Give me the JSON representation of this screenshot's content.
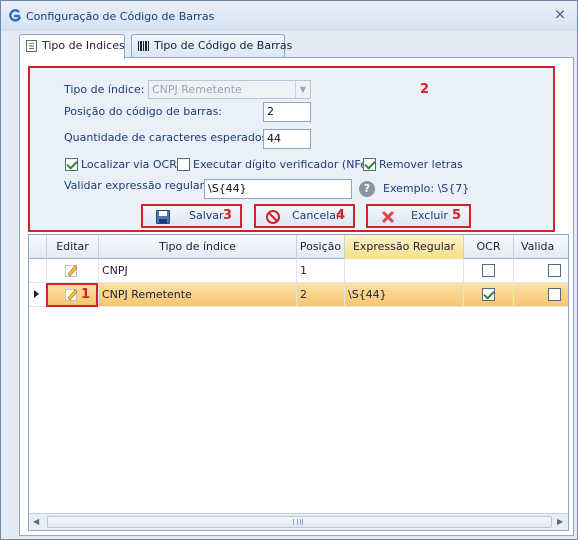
{
  "window": {
    "title": "Configuração de Código de Barras",
    "close_glyph": "×"
  },
  "tabs": [
    {
      "label": "Tipo de Indices",
      "icon": "document-list-icon",
      "active": true
    },
    {
      "label": "Tipo de Código de Barras",
      "icon": "barcode-icon",
      "active": false
    }
  ],
  "form": {
    "section_number": "2",
    "tipo_indice_label": "Tipo de índice:",
    "tipo_indice_value": "CNPJ Remetente",
    "posicao_label": "Posição do código de barras:",
    "posicao_value": "2",
    "quantidade_label": "Quantidade de caracteres esperados:",
    "quantidade_value": "44",
    "checkboxes": [
      {
        "label": "Localizar via OCR",
        "checked": true
      },
      {
        "label": "Executar dígito verificador (NFe)",
        "checked": false
      },
      {
        "label": "Remover letras",
        "checked": true
      }
    ],
    "validar_label": "Validar expressão regular",
    "validar_value": "\\S{44}",
    "help_glyph": "?",
    "exemplo_text": "Exemplo: \\S{7}"
  },
  "buttons": [
    {
      "label": "Salvar",
      "number": "3",
      "icon": "save-disk-icon"
    },
    {
      "label": "Cancelar",
      "number": "4",
      "icon": "cancel-icon"
    },
    {
      "label": "Excluir",
      "number": "5",
      "icon": "delete-x-icon"
    }
  ],
  "grid": {
    "columns": [
      "Editar",
      "Tipo de índice",
      "Posição",
      "Expressão Regular",
      "OCR",
      "Valida"
    ],
    "rows": [
      {
        "tipo": "CNPJ",
        "posicao": "1",
        "expressao": "",
        "ocr": false,
        "selected": false
      },
      {
        "tipo": "CNPJ Remetente",
        "posicao": "2",
        "expressao": "\\S{44}",
        "ocr": true,
        "selected": true
      }
    ],
    "row_edit_number": "1"
  },
  "colors": {
    "annotation_red": "#d2222a",
    "selected_row": "#f6c66f",
    "window_bg": "#e3ebf5"
  }
}
